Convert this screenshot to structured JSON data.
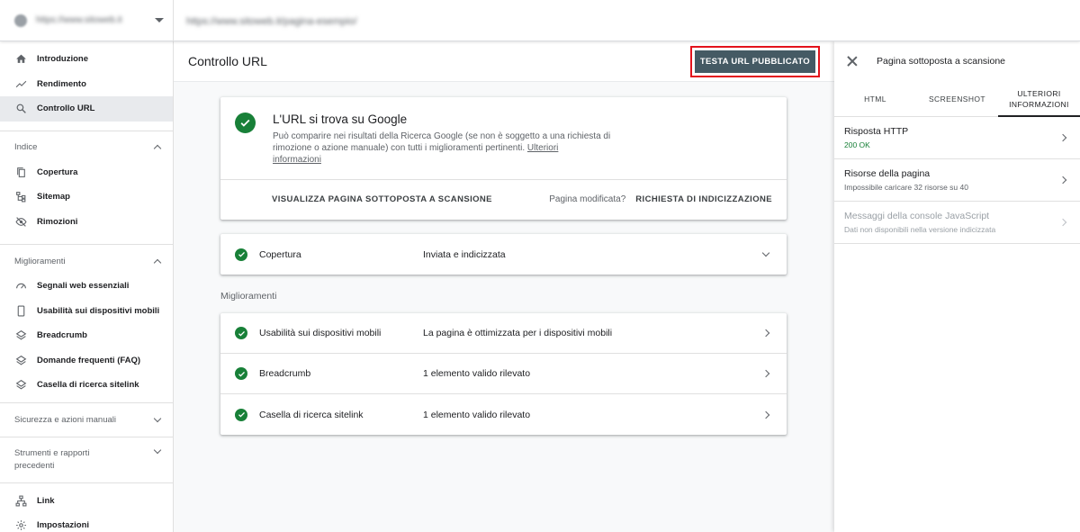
{
  "topbar": {
    "property": "https://www.sitoweb.it",
    "url": "https://www.sitoweb.it/pagina-esempio/"
  },
  "sidebar": {
    "top_items": [
      {
        "label": "Introduzione",
        "icon": "home-icon"
      },
      {
        "label": "Rendimento",
        "icon": "trending-up-icon"
      },
      {
        "label": "Controllo URL",
        "icon": "search-icon"
      }
    ],
    "sections": [
      {
        "title": "Indice",
        "items": [
          {
            "label": "Copertura",
            "icon": "copy-icon"
          },
          {
            "label": "Sitemap",
            "icon": "sitemap-icon"
          },
          {
            "label": "Rimozioni",
            "icon": "eye-off-icon"
          }
        ]
      },
      {
        "title": "Miglioramenti",
        "items": [
          {
            "label": "Segnali web essenziali",
            "icon": "gauge-icon"
          },
          {
            "label": "Usabilità sui dispositivi mobili",
            "icon": "smartphone-icon"
          },
          {
            "label": "Breadcrumb",
            "icon": "layers-icon"
          },
          {
            "label": "Domande frequenti (FAQ)",
            "icon": "layers-icon"
          },
          {
            "label": "Casella di ricerca sitelink",
            "icon": "layers-icon"
          }
        ]
      }
    ],
    "collapsed": [
      "Sicurezza e azioni manuali"
    ],
    "tools_line1": "Strumenti e rapporti",
    "tools_line2": "precedenti",
    "bottom_items": [
      {
        "label": "Link",
        "icon": "network-icon"
      },
      {
        "label": "Impostazioni",
        "icon": "gear-icon"
      }
    ]
  },
  "main": {
    "title": "Controllo URL",
    "test_button": "TESTA URL PUBBLICATO",
    "status": {
      "title": "L'URL si trova su Google",
      "desc": "Può comparire nei risultati della Ricerca Google (se non è soggetto a una richiesta di rimozione o azione manuale) con tutti i miglioramenti pertinenti.",
      "link_line1": "Ulteriori",
      "link_line2": "informazioni",
      "view_crawled": "VISUALIZZA PAGINA SOTTOPOSTA A SCANSIONE",
      "modified_q": "Pagina modificata?",
      "request_index": "RICHIESTA DI INDICIZZAZIONE"
    },
    "coverage": {
      "label": "Copertura",
      "value": "Inviata e indicizzata"
    },
    "enh_heading": "Miglioramenti",
    "enhancements": [
      {
        "label": "Usabilità sui dispositivi mobili",
        "value": "La pagina è ottimizzata per i dispositivi mobili"
      },
      {
        "label": "Breadcrumb",
        "value": "1 elemento valido rilevato"
      },
      {
        "label": "Casella di ricerca sitelink",
        "value": "1 elemento valido rilevato"
      }
    ]
  },
  "panel": {
    "title": "Pagina sottoposta a scansione",
    "tabs": {
      "html": "HTML",
      "screenshot": "SCREENSHOT",
      "more_1": "ULTERIORI",
      "more_2": "INFORMAZIONI"
    },
    "rows": [
      {
        "title": "Risposta HTTP",
        "sub": "200 OK"
      },
      {
        "title": "Risorse della pagina",
        "sub": "Impossibile caricare 32 risorse su 40"
      },
      {
        "title": "Messaggi della console JavaScript",
        "sub": "Dati non disponibili nella versione indicizzata"
      }
    ]
  },
  "colors": {
    "accent_green": "#188038",
    "button": "#455a64",
    "highlight": "#e3121b"
  }
}
